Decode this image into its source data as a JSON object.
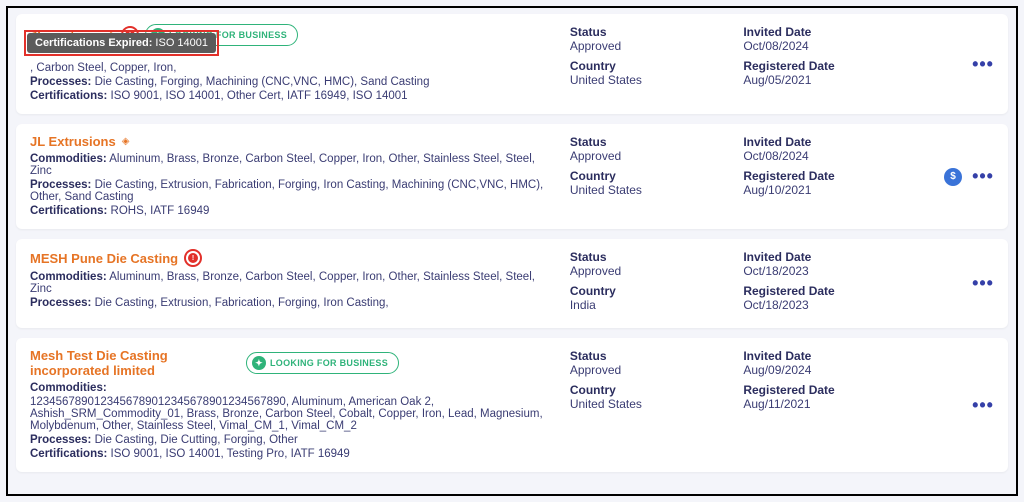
{
  "labels": {
    "status": "Status",
    "country": "Country",
    "invited": "Invited Date",
    "registered": "Registered Date",
    "commodities": "Commodities:",
    "processes": "Processes:",
    "certifications": "Certifications:",
    "lfb": "LOOKING FOR BUSINESS"
  },
  "tooltip": {
    "label": "Certifications Expired:",
    "value": "ISO 14001"
  },
  "rows": [
    {
      "name": "JL castings",
      "verified": true,
      "alert": true,
      "lfb": true,
      "commodities": ", Carbon Steel, Copper, Iron,",
      "processes": "Die Casting, Forging, Machining (CNC,VNC, HMC), Sand Casting",
      "certifications": "ISO 9001, ISO 14001, Other Cert, IATF 16949, ISO 14001",
      "status": "Approved",
      "country": "United States",
      "invited": "Oct/08/2024",
      "registered": "Aug/05/2021",
      "dollar": false
    },
    {
      "name": "JL Extrusions",
      "verified": true,
      "alert": false,
      "lfb": false,
      "commodities": "Aluminum, Brass, Bronze, Carbon Steel, Copper, Iron, Other, Stainless Steel, Steel, Zinc",
      "processes": "Die Casting, Extrusion, Fabrication, Forging, Iron Casting, Machining (CNC,VNC, HMC), Other, Sand Casting",
      "certifications": "ROHS, IATF 16949",
      "status": "Approved",
      "country": "United States",
      "invited": "Oct/08/2024",
      "registered": "Aug/10/2021",
      "dollar": true
    },
    {
      "name": "MESH Pune Die Casting",
      "verified": false,
      "alert": true,
      "lfb": false,
      "commodities": "Aluminum, Brass, Bronze, Carbon Steel, Copper, Iron, Other, Stainless Steel, Steel, Zinc",
      "processes": "Die Casting, Extrusion, Fabrication, Forging, Iron Casting,",
      "certifications": "",
      "status": "Approved",
      "country": "India",
      "invited": "Oct/18/2023",
      "registered": "Oct/18/2023",
      "dollar": false
    },
    {
      "name": "Mesh Test Die Casting incorporated limited",
      "verified": false,
      "alert": false,
      "lfb": true,
      "commodities": "1234567890123456789012345678901234567890, Aluminum, American Oak 2, Ashish_SRM_Commodity_01, Brass, Bronze, Carbon Steel, Cobalt, Copper, Iron, Lead, Magnesium, Molybdenum, Other, Stainless Steel, Vimal_CM_1, Vimal_CM_2",
      "processes": "Die Casting, Die Cutting, Forging, Other",
      "certifications": "ISO 9001, ISO 14001, Testing Pro, IATF 16949",
      "status": "Approved",
      "country": "United States",
      "invited": "Aug/09/2024",
      "registered": "Aug/11/2021",
      "dollar": false
    }
  ]
}
